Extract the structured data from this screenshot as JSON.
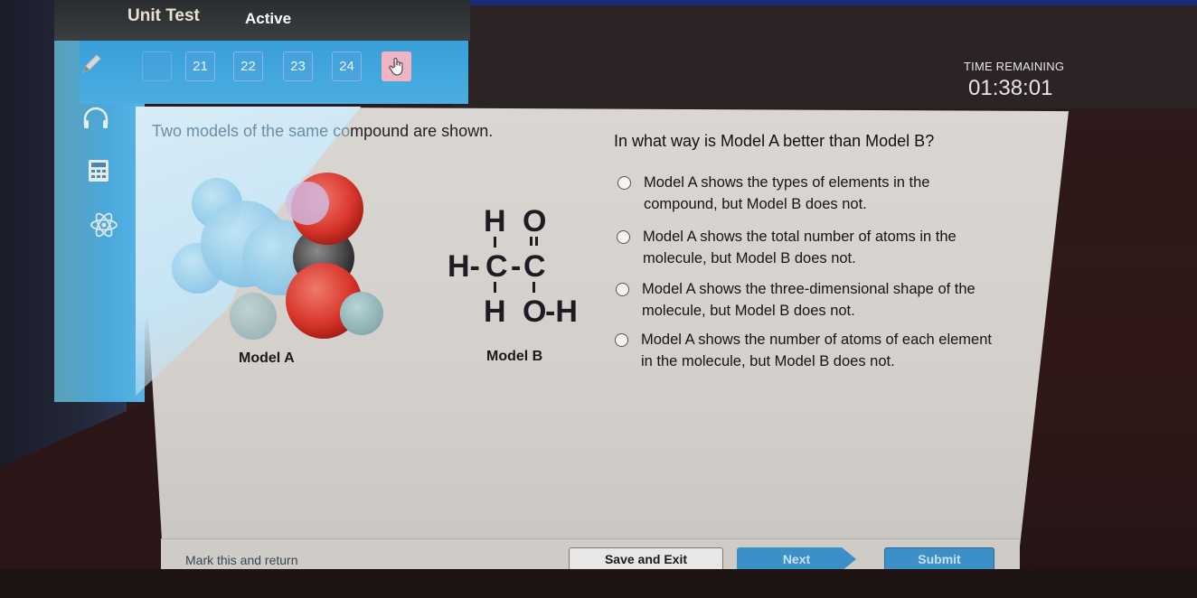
{
  "header": {
    "title": "Unit Test",
    "status": "Active"
  },
  "question_nav": {
    "items": [
      {
        "label": "",
        "state": "faded"
      },
      {
        "label": "21",
        "state": "default"
      },
      {
        "label": "22",
        "state": "default"
      },
      {
        "label": "23",
        "state": "default"
      },
      {
        "label": "24",
        "state": "default"
      }
    ],
    "flag_icon": "pointer-hand-icon"
  },
  "sidebar": {
    "tools": [
      {
        "name": "pencil-icon"
      },
      {
        "name": "headphones-icon"
      },
      {
        "name": "calculator-icon"
      },
      {
        "name": "atom-icon"
      }
    ]
  },
  "timer": {
    "label": "TIME REMAINING",
    "value": "01:38:01"
  },
  "stem": {
    "text_faded": "Two models of the same co",
    "text_rest": "mpound are shown."
  },
  "models": {
    "a_label": "Model A",
    "b_label": "Model B",
    "b_formula": {
      "row1": [
        "H",
        "O"
      ],
      "row2": [
        "H-",
        "C",
        "-",
        "C"
      ],
      "row3": [
        "H",
        "O",
        "-H"
      ]
    },
    "colors": {
      "hydrogen": "#8ab4b8",
      "oxygen": "#d83a30",
      "carbon": "#3a3a3a"
    }
  },
  "question": {
    "prompt": "In what way is Model A better than Model B?",
    "choices": [
      {
        "text": "Model A shows the types of elements in the compound, but Model B does not.",
        "selected": false
      },
      {
        "text": "Model A shows the total number of atoms in the molecule, but Model B does not.",
        "selected": false
      },
      {
        "text": "Model A shows the three-dimensional shape of the molecule, but Model B does not.",
        "selected": false
      },
      {
        "text": "Model A shows the number of atoms of each element in the molecule, but Model B does not.",
        "selected": false
      }
    ]
  },
  "footer": {
    "mark_label": "Mark this and return",
    "save_label": "Save and Exit",
    "next_label": "Next",
    "submit_label": "Submit"
  }
}
